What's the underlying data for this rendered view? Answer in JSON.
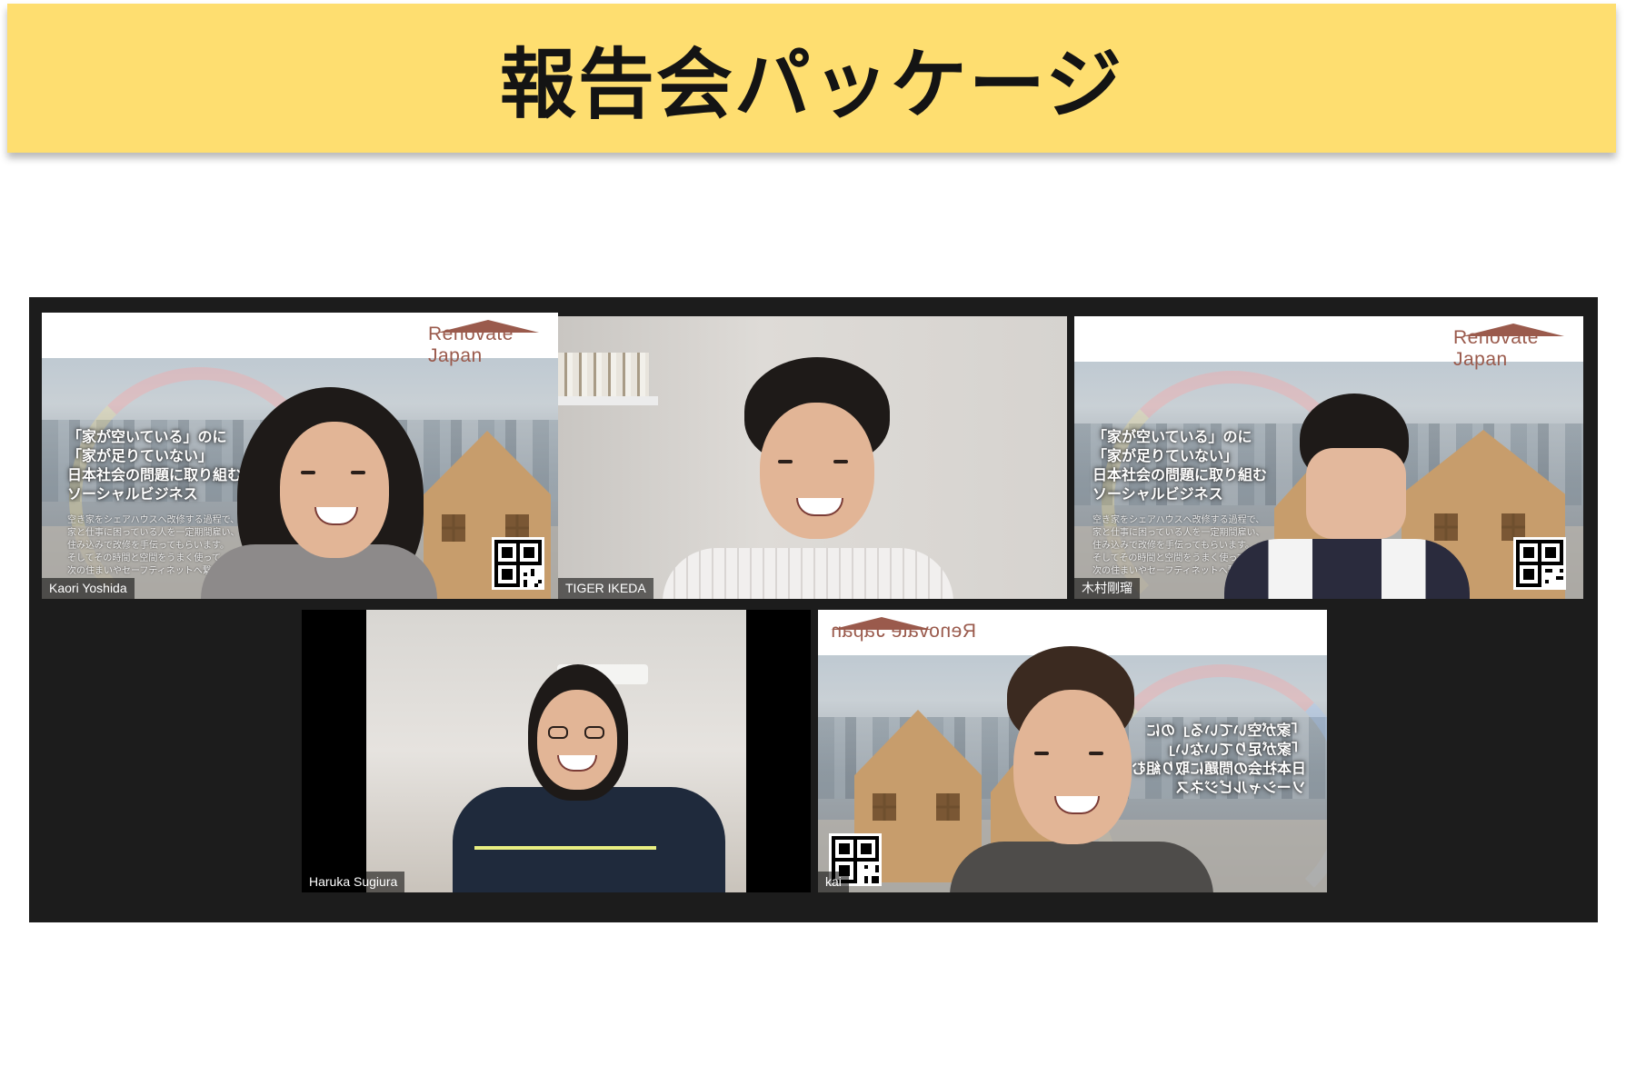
{
  "banner": {
    "title": "報告会パッケージ"
  },
  "gallery": {
    "tiles": [
      {
        "name": "Kaori Yoshida",
        "active": true
      },
      {
        "name": "TIGER IKEDA"
      },
      {
        "name": "木村剛瑠"
      },
      {
        "name": "Haruka Sugiura"
      },
      {
        "name": "kai"
      }
    ],
    "background": {
      "brand": "Renovate Japan",
      "slogan_lines": [
        "「家が空いている」のに",
        "「家が足りていない」",
        "日本社会の問題に取り組む",
        "ソーシャルビジネス"
      ],
      "body_lines": [
        "空き家をシェアハウスへ改修する過程で、",
        "家と仕事に困っている人を一定期間雇い、",
        "住み込みで改修を手伝ってもらいます。",
        "そしてその時間と空間をうまく使って",
        "次の住まいやセーフティネットへ繋ぎます。"
      ]
    }
  },
  "colors": {
    "banner_bg": "#fede70",
    "gallery_bg": "#1c1c1c",
    "active_speaker_border": "#b9e34f",
    "brand": "#9a5a4c"
  }
}
